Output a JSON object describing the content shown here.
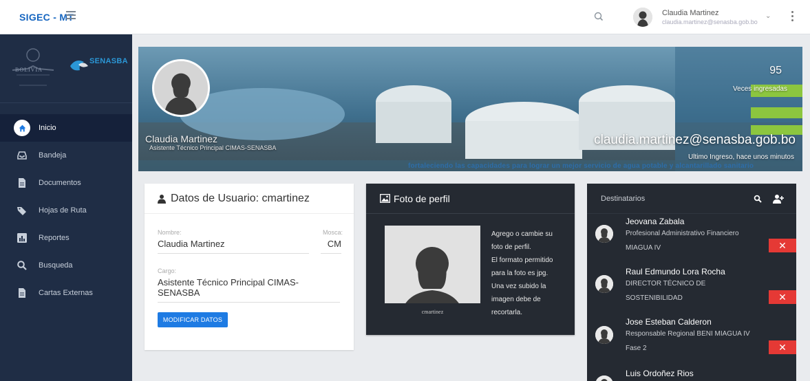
{
  "app": {
    "brand": "SIGEC - MT"
  },
  "header": {
    "user_name": "Claudia Martinez",
    "user_email": "claudia.martinez@senasba.gob.bo"
  },
  "sidebar": {
    "logo_left": "BOLIVIA",
    "logo_right": "SENASBA",
    "items": [
      {
        "label": "Inicio",
        "icon": "home-icon",
        "active": true
      },
      {
        "label": "Bandeja",
        "icon": "inbox-icon",
        "active": false
      },
      {
        "label": "Documentos",
        "icon": "document-icon",
        "active": false
      },
      {
        "label": "Hojas de Ruta",
        "icon": "tags-icon",
        "active": false
      },
      {
        "label": "Reportes",
        "icon": "bar-chart-icon",
        "active": false
      },
      {
        "label": "Busqueda",
        "icon": "search-icon",
        "active": false
      },
      {
        "label": "Cartas Externas",
        "icon": "document-icon",
        "active": false
      }
    ]
  },
  "banner": {
    "name": "Claudia Martinez",
    "role": "Asistente Técnico Principal CIMAS-SENASBA",
    "count": "95",
    "count_label": "Veces ingresadas",
    "email": "claudia.martinez@senasba.gob.bo",
    "last_login": "Ultimo Ingreso, hace unos minutos",
    "slogan": "fortaleciendo las capacidades para lograr un mejor servicio de agua potable y alcantarillado sanitario"
  },
  "user_card": {
    "title": "Datos de Usuario: cmartinez",
    "name_label": "Nombre:",
    "name_value": "Claudia Martinez",
    "mosca_label": "Mosca:",
    "mosca_value": "CM",
    "cargo_label": "Cargo:",
    "cargo_value": "Asistente Técnico Principal CIMAS-SENASBA",
    "button": "MODIFICAR DATOS"
  },
  "photo_card": {
    "title": "Foto de perfil",
    "caption": "cmartinez",
    "lines": [
      "Agrego o cambie su",
      "foto de perfil.",
      "El formato permitido",
      "para la foto es jpg.",
      "Una vez subido la",
      "imagen debe de",
      "recortarla."
    ]
  },
  "recipients": {
    "title": "Destinatarios",
    "remove_label": "✕",
    "items": [
      {
        "name": "Jeovana Zabala",
        "role_lines": [
          "Profesional Administrativo Financiero",
          "MIAGUA IV"
        ]
      },
      {
        "name": "Raul Edmundo Lora Rocha",
        "role_lines": [
          "DIRECTOR TÉCNICO DE",
          "SOSTENIBILIDAD"
        ]
      },
      {
        "name": "Jose Esteban Calderon",
        "role_lines": [
          "Responsable Regional BENI MIAGUA IV",
          "Fase 2"
        ]
      },
      {
        "name": "Luis Ordoñez Rios",
        "role_lines": []
      }
    ]
  },
  "colors": {
    "sidebar": "#1f2d45",
    "primary": "#1e7be3",
    "danger": "#e53935",
    "dark_card": "#252a32",
    "brand": "#1565c0"
  }
}
